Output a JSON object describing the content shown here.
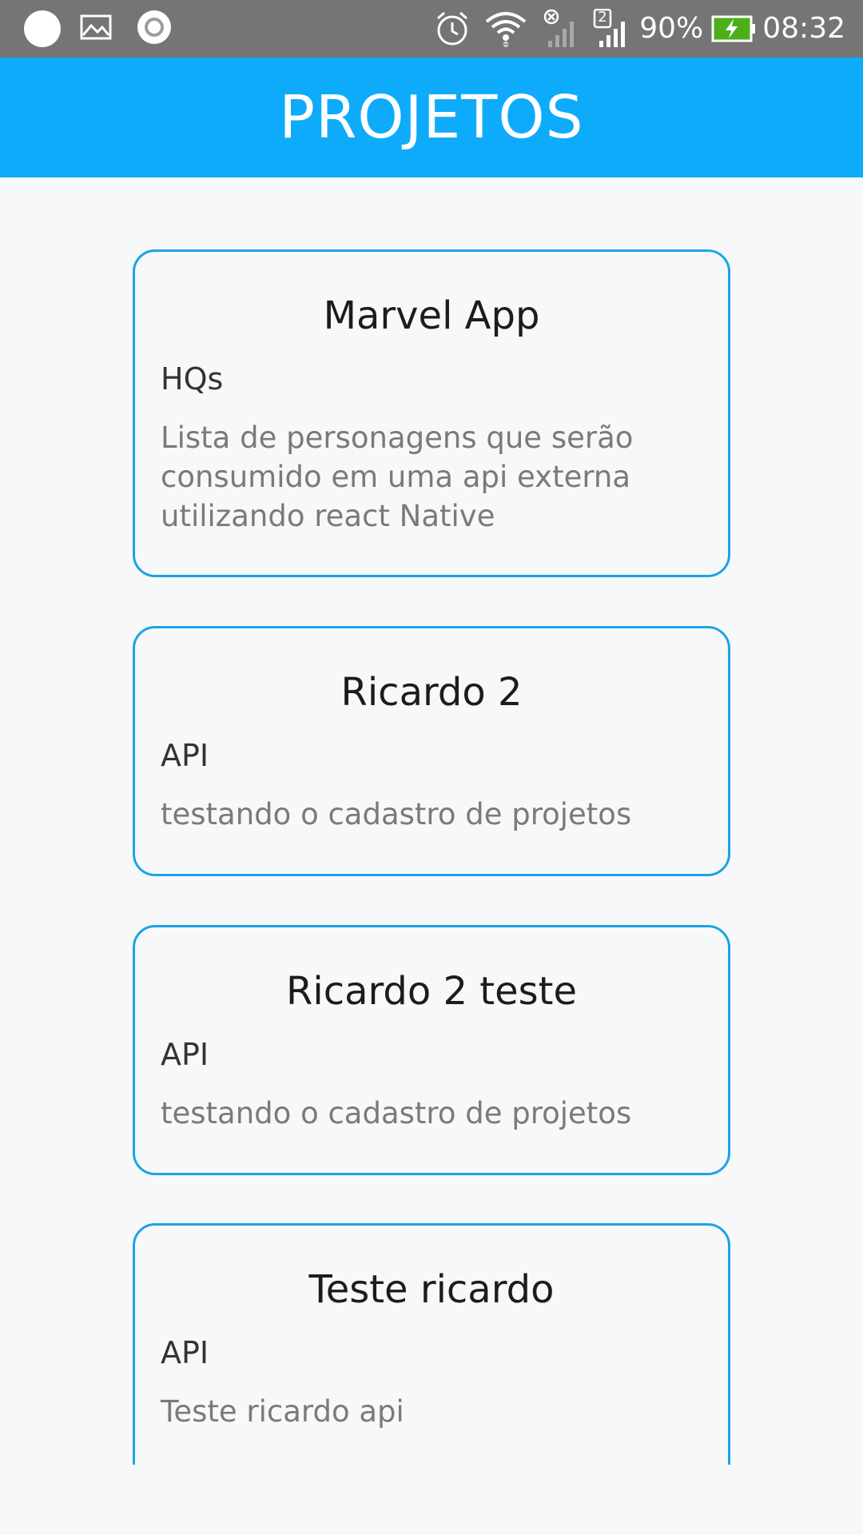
{
  "status_bar": {
    "battery_percent": "90%",
    "time": "08:32",
    "sim_badge": "2",
    "icons": [
      "notification-dot-icon",
      "image-icon",
      "record-icon",
      "alarm-icon",
      "wifi-icon",
      "no-signal-icon",
      "signal-icon",
      "battery-charging-icon"
    ]
  },
  "app_bar": {
    "title": "PROJETOS"
  },
  "projects": [
    {
      "title": "Marvel App",
      "category": "HQs",
      "description": "Lista de personagens que serão consumido em uma api externa utilizando react Native"
    },
    {
      "title": "Ricardo 2",
      "category": "API",
      "description": "testando o cadastro de projetos"
    },
    {
      "title": "Ricardo 2 teste",
      "category": "API",
      "description": "testando o cadastro de projetos"
    },
    {
      "title": "Teste ricardo",
      "category": "API",
      "description": "Teste ricardo api"
    }
  ],
  "colors": {
    "status_bar": "#757575",
    "app_bar": "#0eabfb",
    "card_border": "#19a5e6",
    "background": "#f7f8f9",
    "battery_fill": "#4caf1a"
  }
}
